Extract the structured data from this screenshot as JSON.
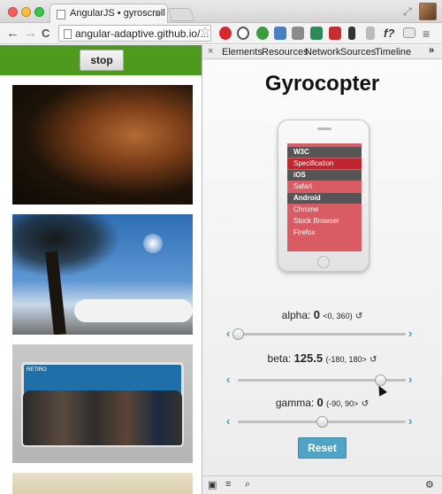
{
  "browser": {
    "tab_title": "AngularJS • gyroscroll",
    "tab_close": "×",
    "url": "angular-adaptive.github.io/...",
    "back": "←",
    "forward": "→",
    "reload": "C",
    "star": "☆",
    "expand": "⤢"
  },
  "left_page": {
    "stop_label": "stop",
    "subway_sign": "RETIRO"
  },
  "devtools": {
    "close": "×",
    "tabs": [
      "Elements",
      "Resources",
      "Network",
      "Sources",
      "Timeline"
    ],
    "more": "»",
    "bottom_icons": [
      "▣",
      "≡",
      "⌕",
      "⚙"
    ]
  },
  "app": {
    "title": "Gyrocopter",
    "list": [
      {
        "label": "W3C",
        "kind": "header"
      },
      {
        "label": "Specification",
        "kind": "active"
      },
      {
        "label": "iOS",
        "kind": "header"
      },
      {
        "label": "Safari",
        "kind": "sub"
      },
      {
        "label": "Android",
        "kind": "header"
      },
      {
        "label": "Chrome",
        "kind": "sub"
      },
      {
        "label": "Stock Browser",
        "kind": "sub"
      },
      {
        "label": "Firefox",
        "kind": "sub"
      }
    ],
    "controls": [
      {
        "name": "alpha",
        "value": "0",
        "range": "<0, 360)",
        "min": 0,
        "max": 360,
        "num": 0
      },
      {
        "name": "beta",
        "value": "125.5",
        "range": "(-180, 180>",
        "min": -180,
        "max": 180,
        "num": 125.5
      },
      {
        "name": "gamma",
        "value": "0",
        "range": "(-90, 90>",
        "min": -90,
        "max": 90,
        "num": 0
      }
    ],
    "reset_glyph": "↺",
    "arrow_left": "‹",
    "arrow_right": "›",
    "reset_label": "Reset"
  },
  "colors": {
    "accent": "#4fa3c4",
    "list_red": "#d95b63",
    "list_active": "#c0262f",
    "green_bar": "#4e9a1f"
  }
}
